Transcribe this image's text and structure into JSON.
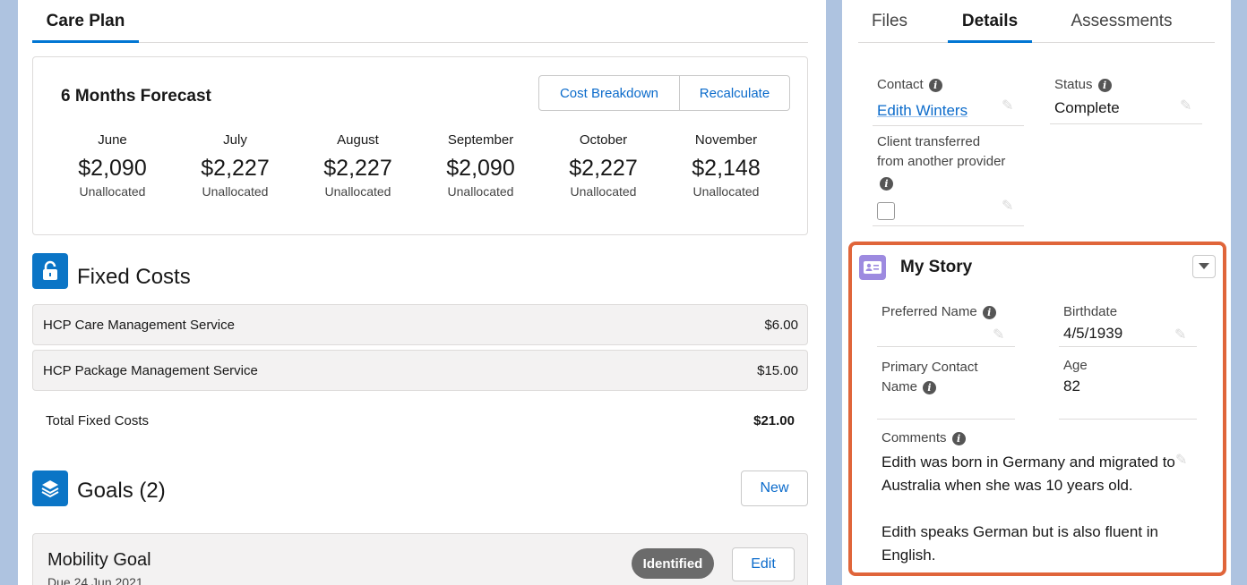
{
  "care_plan": {
    "tab_label": "Care Plan",
    "forecast": {
      "title": "6 Months Forecast",
      "cost_breakdown_label": "Cost Breakdown",
      "recalculate_label": "Recalculate",
      "months": [
        {
          "name": "June",
          "value": "$2,090",
          "sub": "Unallocated"
        },
        {
          "name": "July",
          "value": "$2,227",
          "sub": "Unallocated"
        },
        {
          "name": "August",
          "value": "$2,227",
          "sub": "Unallocated"
        },
        {
          "name": "September",
          "value": "$2,090",
          "sub": "Unallocated"
        },
        {
          "name": "October",
          "value": "$2,227",
          "sub": "Unallocated"
        },
        {
          "name": "November",
          "value": "$2,148",
          "sub": "Unallocated"
        }
      ]
    },
    "fixed_costs": {
      "title": "Fixed Costs",
      "icon": "lock-icon",
      "rows": [
        {
          "name": "HCP Care Management Service",
          "value": "$6.00"
        },
        {
          "name": "HCP Package Management Service",
          "value": "$15.00"
        }
      ],
      "total_label": "Total Fixed Costs",
      "total_value": "$21.00"
    },
    "goals": {
      "title": "Goals (2)",
      "icon": "layers-icon",
      "new_label": "New",
      "items": [
        {
          "title": "Mobility Goal",
          "sub": "Due 24 Jun 2021",
          "badge": "Identified",
          "edit_label": "Edit"
        }
      ]
    }
  },
  "details_panel": {
    "tabs": [
      "Files",
      "Details",
      "Assessments"
    ],
    "active_tab": "Details",
    "contact": {
      "label": "Contact",
      "value": "Edith Winters"
    },
    "status": {
      "label": "Status",
      "value": "Complete"
    },
    "transferred": {
      "label_line1": "Client transferred",
      "label_line2": "from another provider",
      "checked": false
    },
    "my_story": {
      "title": "My Story",
      "preferred_name": {
        "label": "Preferred Name",
        "value": ""
      },
      "birthdate": {
        "label": "Birthdate",
        "value": "4/5/1939"
      },
      "primary_contact": {
        "label_line1": "Primary Contact",
        "label_line2": "Name",
        "value": ""
      },
      "age": {
        "label": "Age",
        "value": "82"
      },
      "comments": {
        "label": "Comments",
        "para1": "Edith was born in Germany and migrated to Australia when she was 10 years old.",
        "para2": "Edith speaks German but is also fluent in English."
      }
    }
  },
  "colors": {
    "brand_blue": "#0b75c6",
    "link": "#0b6bcb",
    "highlight_border": "#e0653a",
    "story_icon": "#9d8ae0",
    "badge": "#6b6b6b"
  }
}
